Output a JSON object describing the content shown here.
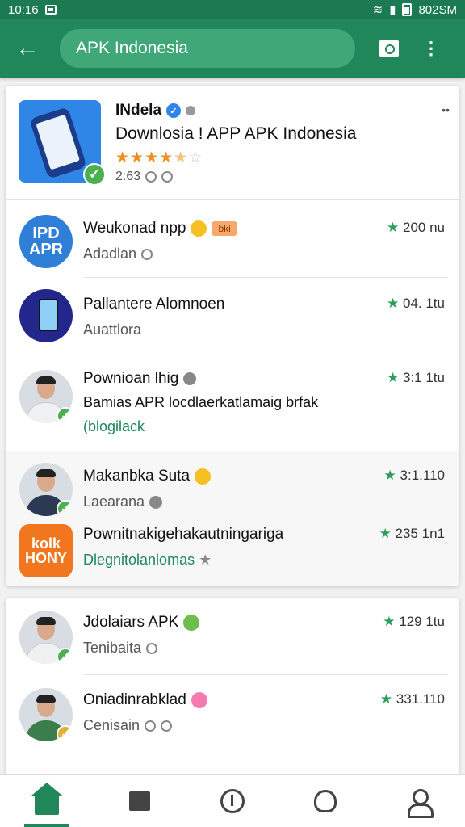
{
  "status_bar": {
    "time": "10:16",
    "right_text": "802SM"
  },
  "app_bar": {
    "search_text": "APK Indonesia"
  },
  "featured": {
    "title": "INdela",
    "subtitle": "Downlosia ! APP APK Indonesia",
    "rating_stars": 4,
    "meta": "2:63"
  },
  "list": [
    {
      "title": "Weukonad npp",
      "tag": "bki",
      "subtitle": "Adadlan",
      "rating": "200 nu"
    },
    {
      "title": "Pallantere Alomnoen",
      "subtitle": "Auattlora",
      "rating": "04. 1tu"
    },
    {
      "title": "Pownioan lhig",
      "desc": "Bamias APR locdlaerkatlamaig brfak",
      "link": "(blogilack",
      "rating": "3:1 1tu"
    },
    {
      "title": "Makanbka Suta",
      "subtitle": "Laearana",
      "rating": "3:1.110"
    },
    {
      "title": "Pownitnakigehakautningariga",
      "link": "Dlegnitolanlomas",
      "rating": "235 1n1",
      "icon_text": [
        "kolk",
        "HONY"
      ]
    }
  ],
  "list2": [
    {
      "title": "Jdolaiars APK",
      "subtitle": "Tenibaita",
      "rating": "129 1tu"
    },
    {
      "title": "Oniadinrabklad",
      "subtitle": "Cenisain",
      "rating": "331.110"
    }
  ],
  "colors": {
    "primary": "#1f8759",
    "accent_star": "#f18e1e",
    "rating_star": "#2e9e5b"
  },
  "icons": [
    "back-arrow-icon",
    "bag-icon",
    "kebab-icon",
    "home-icon",
    "apps-icon",
    "clock-icon",
    "bell-icon",
    "account-icon"
  ]
}
